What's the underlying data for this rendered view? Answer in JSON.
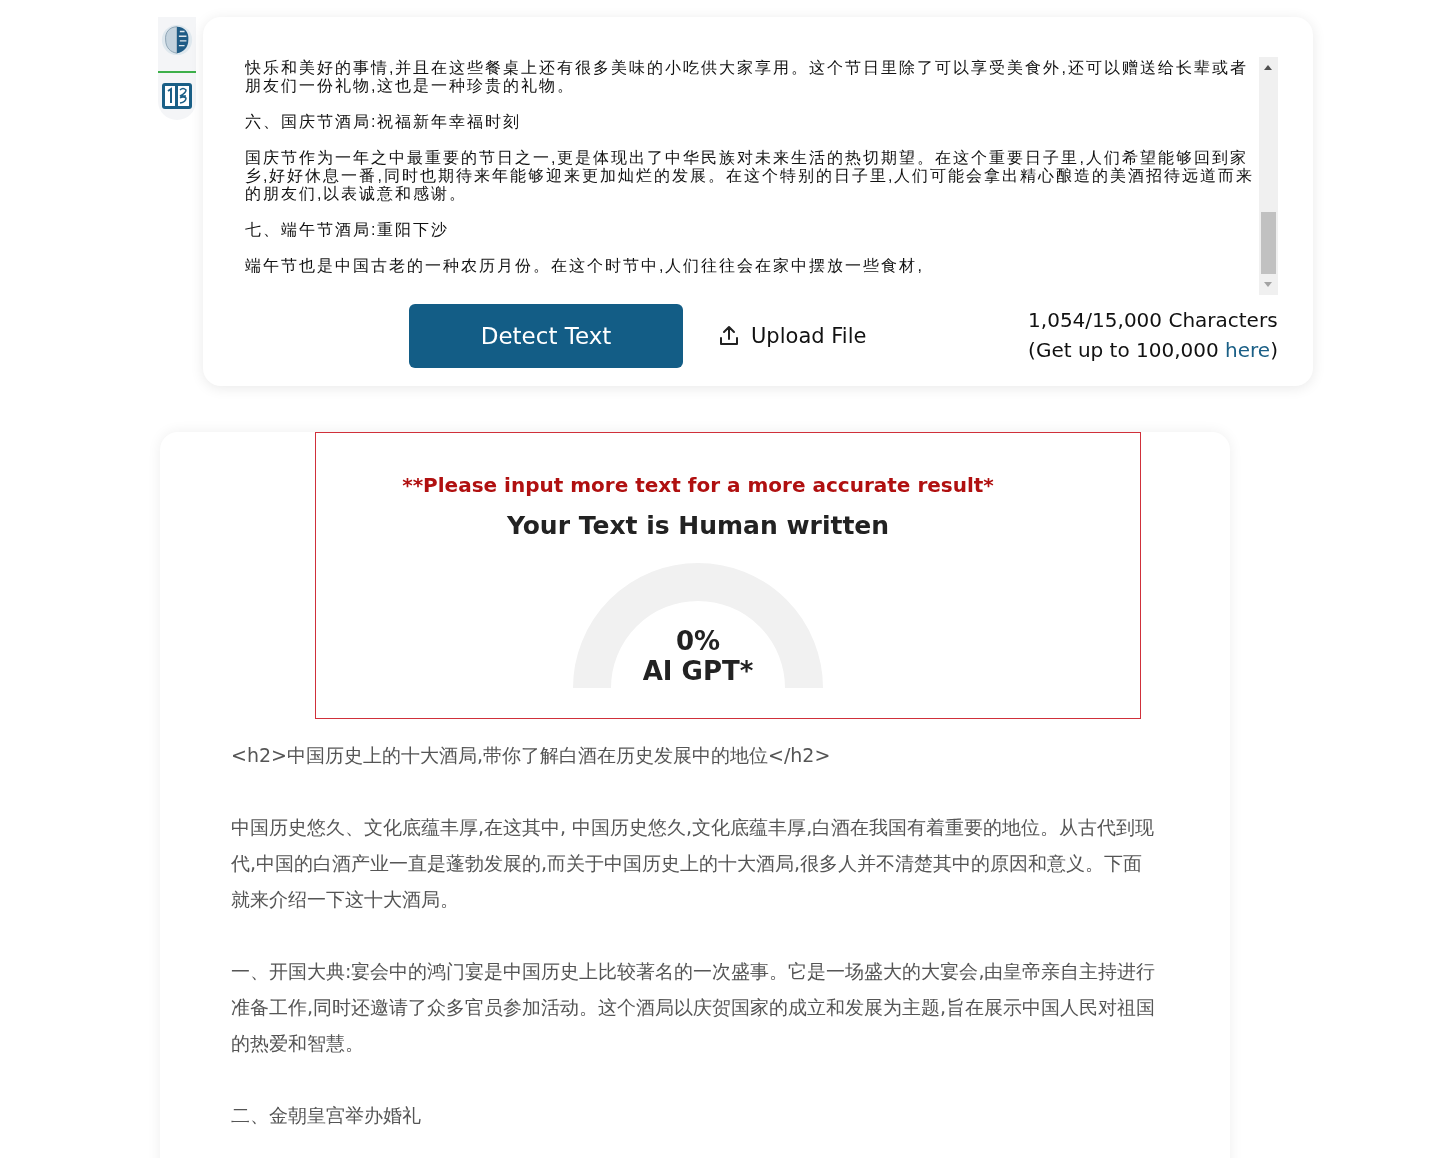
{
  "input": {
    "paragraphs": [
      "快乐和美好的事情,并且在这些餐桌上还有很多美味的小吃供大家享用。这个节日里除了可以享受美食外,还可以赠送给长辈或者朋友们一份礼物,这也是一种珍贵的礼物。",
      "六、国庆节酒局:祝福新年幸福时刻",
      "国庆节作为一年之中最重要的节日之一,更是体现出了中华民族对未来生活的热切期望。在这个重要日子里,人们希望能够回到家乡,好好休息一番,同时也期待来年能够迎来更加灿烂的发展。在这个特别的日子里,人们可能会拿出精心酿造的美酒招待远道而来的朋友们,以表诚意和感谢。",
      "七、端午节酒局:重阳下沙",
      "端午节也是中国古老的一种农历月份。在这个时节中,人们往往会在家中摆放一些食材,"
    ]
  },
  "actions": {
    "detect": "Detect Text",
    "upload": "Upload File",
    "count": "1,054/15,000 Characters",
    "upsell_prefix": "(Get up to 100,000 ",
    "upsell_link": "here",
    "upsell_suffix": ")"
  },
  "result": {
    "warning": "**Please input more text for a more accurate result*",
    "verdict": "Your Text is Human written",
    "gauge": {
      "percent": "0%",
      "label": "AI GPT*"
    }
  },
  "article": [
    "<h2>中国历史上的十大酒局,带你了解白酒在历史发展中的地位</h2>",
    "中国历史悠久、文化底蕴丰厚,在这其中, 中国历史悠久,文化底蕴丰厚,白酒在我国有着重要的地位。从古代到现代,中国的白酒产业一直是蓬勃发展的,而关于中国历史上的十大酒局,很多人并不清楚其中的原因和意义。下面就来介绍一下这十大酒局。",
    "一、开国大典:宴会中的鸿门宴是中国历史上比较著名的一次盛事。它是一场盛大的大宴会,由皇帝亲自主持进行准备工作,同时还邀请了众多官员参加活动。这个酒局以庆贺国家的成立和发展为主题,旨在展示中国人民对祖国的热爱和智慧。",
    "二、金朝皇宫举办婚礼"
  ]
}
